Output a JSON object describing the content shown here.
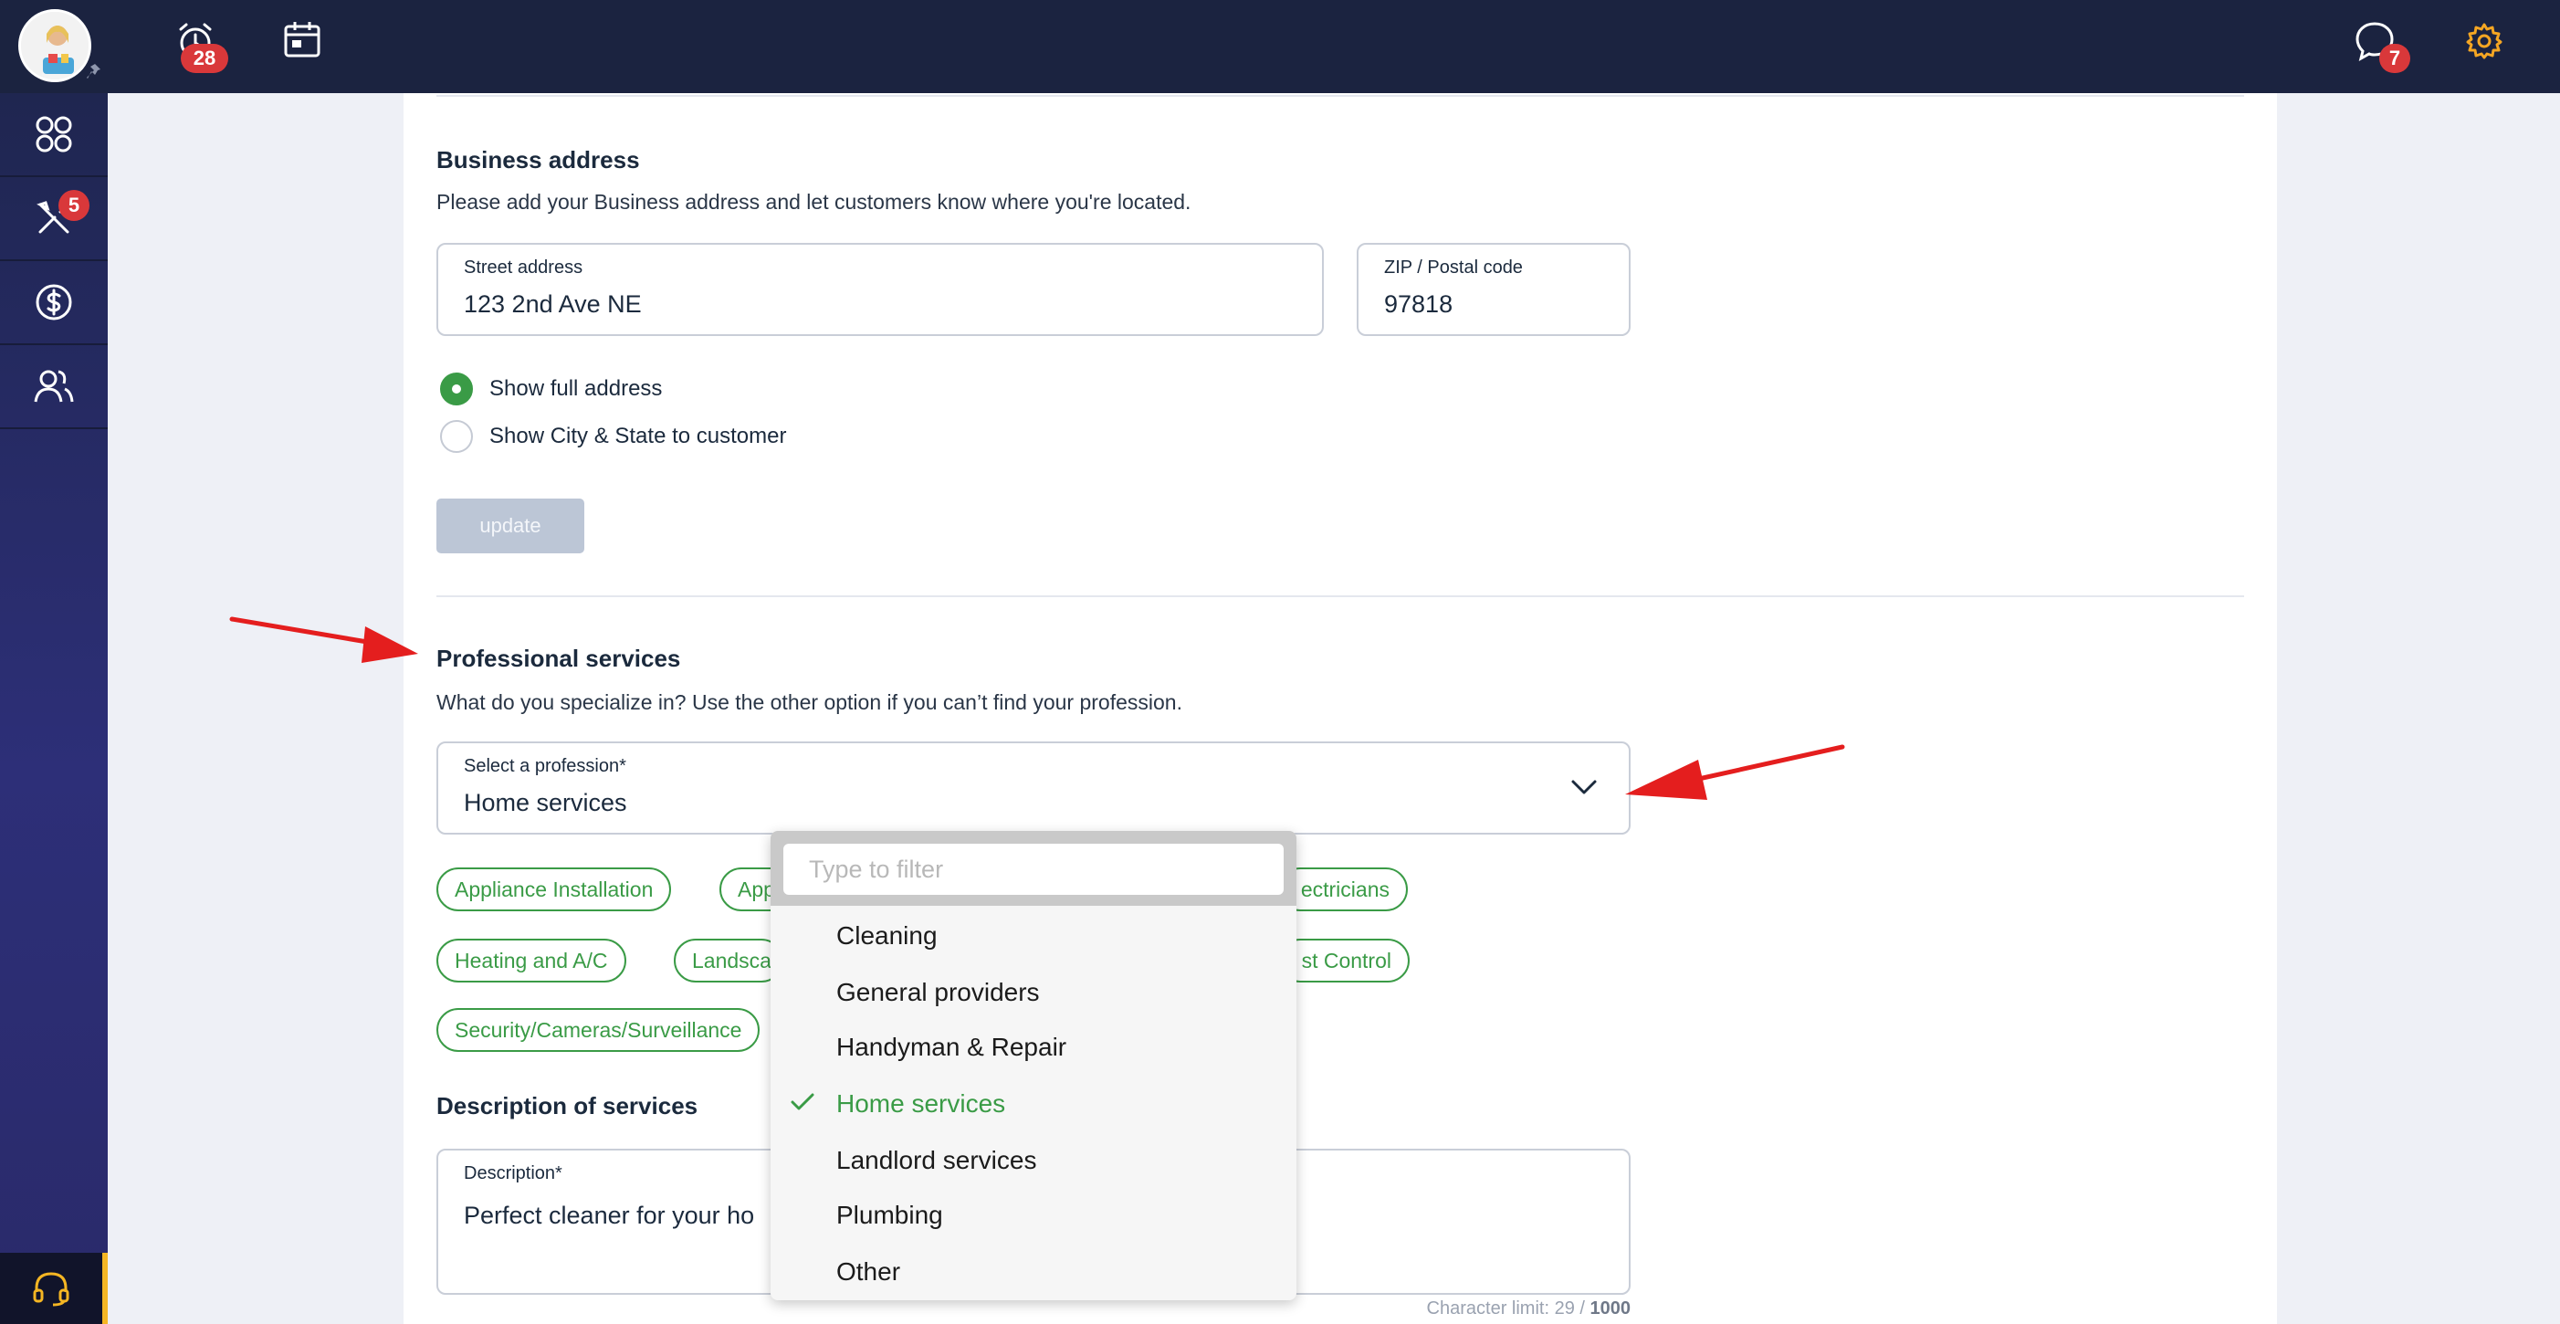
{
  "topbar": {
    "alarm_badge": "28",
    "chat_badge": "7"
  },
  "sidebar": {
    "tools_badge": "5"
  },
  "business_address": {
    "title": "Business address",
    "subtitle": "Please add your Business address and let customers know where you're located.",
    "street_label": "Street address",
    "street_value": "123 2nd Ave NE",
    "zip_label": "ZIP / Postal code",
    "zip_value": "97818",
    "radio_full": "Show full address",
    "radio_city": "Show City & State to customer",
    "update_label": "update"
  },
  "professional": {
    "title": "Professional services",
    "subtitle": "What do you specialize in? Use the other option if you can’t find your profession.",
    "select_label": "Select a profession*",
    "select_value": "Home services",
    "chips": [
      "Appliance Installation",
      "App",
      "ectricians",
      "Heating and A/C",
      "Landsca",
      "st Control",
      "Security/Cameras/Surveillance"
    ]
  },
  "description": {
    "title": "Description of services",
    "label": "Description*",
    "value": "Perfect cleaner for your ho",
    "char_limit_prefix": "Character limit: 29 / ",
    "char_limit_max": "1000"
  },
  "dropdown": {
    "placeholder": "Type to filter",
    "options": [
      "Cleaning",
      "General providers",
      "Handyman & Repair",
      "Home services",
      "Landlord services",
      "Plumbing",
      "Other"
    ],
    "selected": "Home services"
  },
  "colors": {
    "topbar": "#1b2340",
    "accent_green": "#3a9b46",
    "badge_red": "#d9383a",
    "support_yellow": "#f5b623",
    "arrow_red": "#e41e1e"
  }
}
